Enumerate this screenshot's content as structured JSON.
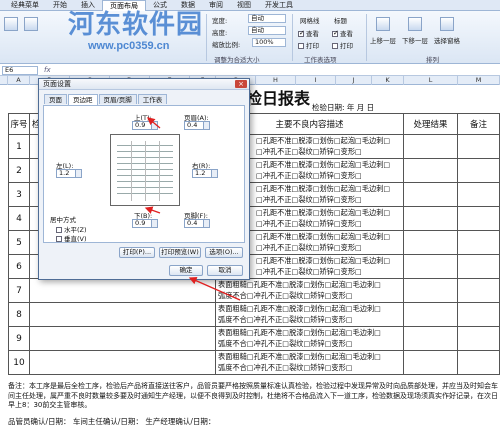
{
  "ribbon": {
    "tabs": [
      "经典菜单",
      "开始",
      "插入",
      "页面布局",
      "公式",
      "数据",
      "审阅",
      "视图",
      "开发工具"
    ],
    "active_tab": "页面布局",
    "width_label": "宽度:",
    "width_value": "自动",
    "height_label": "高度:",
    "height_value": "自动",
    "scale_label": "缩放比例:",
    "scale_value": "100%",
    "group_fit": "调整为合适大小",
    "gridlines_label": "网格线",
    "headings_label": "标题",
    "view_label": "查看",
    "print_label": "打印",
    "group_sheet": "工作表选项",
    "arrange_buttons": [
      "上移一层",
      "下移一层",
      "选择窗格"
    ],
    "group_arrange": "排列"
  },
  "watermark": {
    "line1": "河东软件园",
    "line2": "www.pc0359.cn"
  },
  "formula_bar": {
    "name_box": "E6"
  },
  "columns": [
    "A",
    "B",
    "C",
    "D",
    "E",
    "F",
    "G",
    "H",
    "I",
    "J",
    "K",
    "L",
    "M"
  ],
  "sheet": {
    "title": "检日报表",
    "date_line": "检验日期:      年    月    日",
    "headers": {
      "seq": "序号",
      "check": "检",
      "defects": "主要不良内容描述",
      "result": "处理结果",
      "remark": "备注"
    },
    "rows": [
      "1",
      "2",
      "3",
      "4",
      "5",
      "6",
      "7",
      "8",
      "9",
      "10"
    ],
    "defect_line_a": "□孔距不准□脱漆□划伤□起泡□毛边刺□",
    "defect_line_b": "□冲孔不正□裂纹□矫锌□变形□",
    "defect_line_a2": "表面粗糙□孔距不准□脱漆□划伤□起泡□毛边刺□",
    "defect_line_b2": "弧度不合□冲孔不正□裂纹□矫锌□变形□",
    "note": "备注：本工序是最后全检工序，检验后产品将直接送往客户，品管员要严格按照质量标准认真检验，检验过程中发现异常及时向品质部处理，并应当及时知会车间主任处理，属严重不良时数量较多要及时通知生产经理，以便不良得到及时控制，杜绝将不合格品流入下一道工序，检验数据及现场须真实作好记录，在次日早上8：30前交主管审核。",
    "signatures": "品管员确认/日期：                 车间主任确认/日期：                           生产经理确认/日期："
  },
  "dialog": {
    "title": "页面设置",
    "close_label": "×",
    "tabs": [
      "页面",
      "页边距",
      "页眉/页脚",
      "工作表"
    ],
    "active_tab": "页边距",
    "top_label": "上(T):",
    "top_value": "0.9",
    "header_label": "页眉(A):",
    "header_value": "0.4",
    "left_label": "左(L):",
    "left_value": "1.2",
    "right_label": "右(R):",
    "right_value": "1.2",
    "bottom_label": "下(B):",
    "bottom_value": "0.9",
    "footer_label": "页脚(F):",
    "footer_value": "0.4",
    "center_label": "居中方式",
    "horizontal_label": "水平(Z)",
    "vertical_label": "垂直(V)",
    "print_btn": "打印(P)...",
    "preview_btn": "打印预览(W)",
    "options_btn": "选项(O)...",
    "ok_btn": "确定",
    "cancel_btn": "取消"
  },
  "colors": {
    "arrow": "#e02020",
    "dialog_border": "#4f6d96"
  }
}
